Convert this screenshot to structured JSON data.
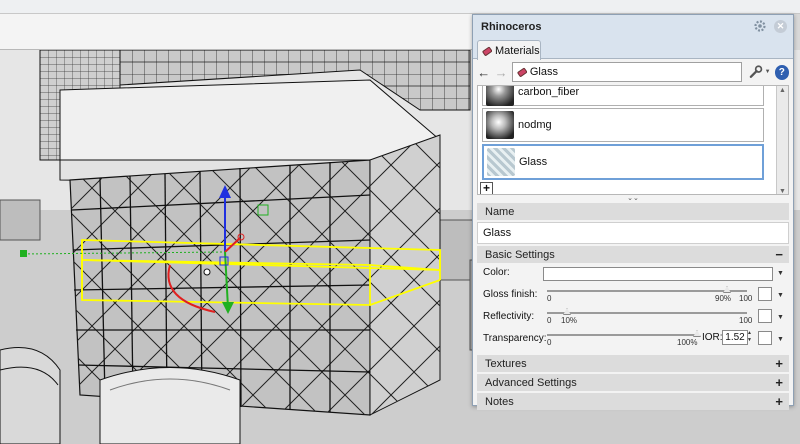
{
  "panel": {
    "title": "Rhinoceros",
    "tab_label": "Materials",
    "current_material": "Glass",
    "materials": [
      {
        "name": "carbon_fiber",
        "selected": false
      },
      {
        "name": "nodmg",
        "selected": false
      },
      {
        "name": "Glass",
        "selected": true
      }
    ],
    "name_section": {
      "header": "Name",
      "value": "Glass"
    },
    "basic_settings": {
      "header": "Basic Settings",
      "toggle": "−",
      "color_label": "Color:",
      "gloss_label": "Gloss finish:",
      "gloss_min": "0",
      "gloss_value": "90%",
      "gloss_max": "100",
      "gloss_fraction": 0.9,
      "reflectivity_label": "Reflectivity:",
      "reflectivity_min": "0",
      "reflectivity_value": "10%",
      "reflectivity_max": "100",
      "reflectivity_fraction": 0.1,
      "transparency_label": "Transparency:",
      "transparency_min": "0",
      "transparency_value": "100%",
      "transparency_fraction": 1.0,
      "ior_label": "IOR:",
      "ior_value": "1.52"
    },
    "collapsed_sections": [
      {
        "header": "Textures",
        "toggle": "+"
      },
      {
        "header": "Advanced Settings",
        "toggle": "+"
      },
      {
        "header": "Notes",
        "toggle": "+"
      }
    ]
  },
  "colors": {
    "panel_title_bg": "#d9e3ee",
    "selection_outline": "#ffff00",
    "gizmo_x": "#e02020",
    "gizmo_y": "#20b020",
    "gizmo_z": "#2030e0"
  },
  "icons": [
    "gear-icon",
    "close-icon",
    "materials-icon",
    "back-arrow-icon",
    "forward-arrow-icon",
    "wrench-icon",
    "help-icon",
    "add-material-icon"
  ]
}
